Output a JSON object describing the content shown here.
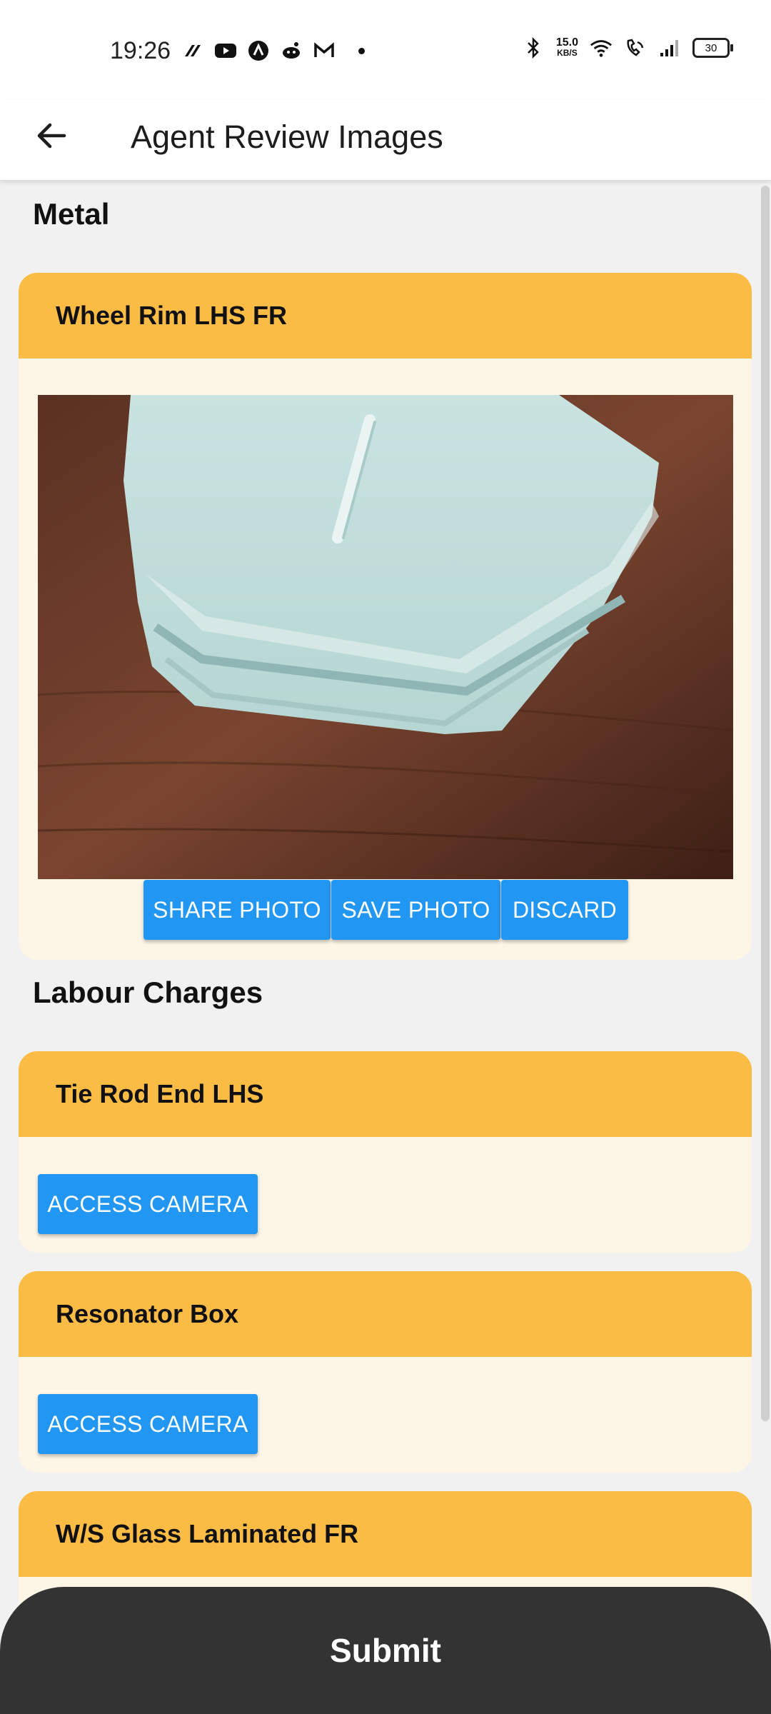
{
  "status_bar": {
    "time": "19:26",
    "net_speed_value": "15.0",
    "net_speed_unit": "KB/S",
    "battery": "30"
  },
  "app_bar": {
    "title": "Agent Review Images"
  },
  "sections": [
    {
      "title": "Metal",
      "cards": [
        {
          "title": "Wheel Rim LHS FR",
          "buttons": [
            "SHARE PHOTO",
            "SAVE PHOTO",
            "DISCARD"
          ]
        }
      ]
    },
    {
      "title": "Labour Charges",
      "cards": [
        {
          "title": "Tie Rod End LHS",
          "button": "ACCESS CAMERA"
        },
        {
          "title": "Resonator Box",
          "button": "ACCESS CAMERA"
        },
        {
          "title": "W/S Glass Laminated FR"
        }
      ]
    }
  ],
  "footer": {
    "submit_label": "Submit"
  },
  "colors": {
    "card_header": "#fbbc46",
    "card_body": "#fdf5e6",
    "button": "#2196f3",
    "submit_bar": "#333333"
  }
}
